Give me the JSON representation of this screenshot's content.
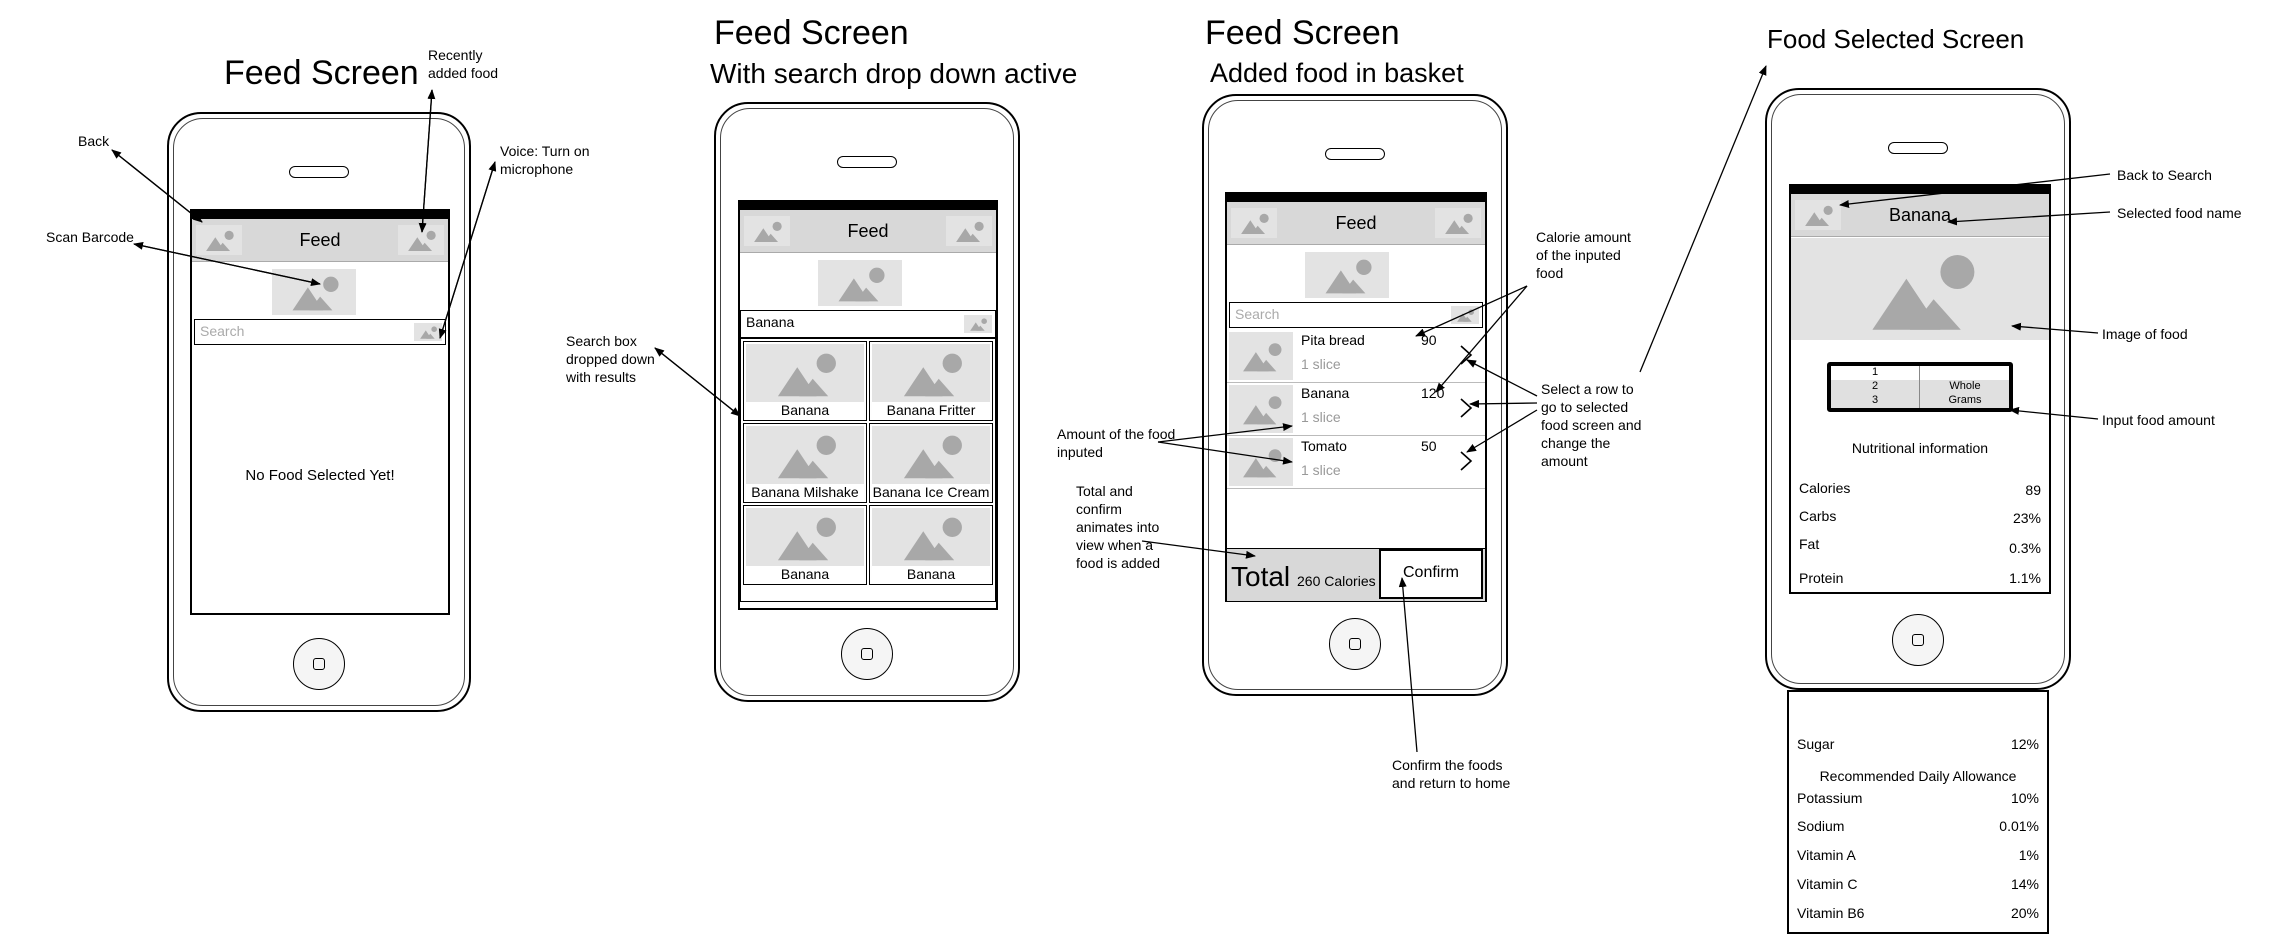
{
  "screen1": {
    "title": "Feed Screen",
    "nav_title": "Feed",
    "search_placeholder": "Search",
    "empty_text": "No Food Selected Yet!"
  },
  "screen2": {
    "title": "Feed Screen",
    "subtitle": "With search drop down active",
    "nav_title": "Feed",
    "search_value": "Banana",
    "results": [
      "Banana",
      "Banana Fritter",
      "Banana Milshake",
      "Banana Ice Cream",
      "Banana",
      "Banana"
    ]
  },
  "screen3": {
    "title": "Feed Screen",
    "subtitle": "Added food in basket",
    "nav_title": "Feed",
    "search_placeholder": "Search",
    "items": [
      {
        "name": "Pita bread",
        "calories": "90",
        "amount": "1 slice"
      },
      {
        "name": "Banana",
        "calories": "120",
        "amount": "1 slice"
      },
      {
        "name": "Tomato",
        "calories": "50",
        "amount": "1 slice"
      }
    ],
    "total_label": "Total",
    "total_value": "260 Calories",
    "confirm_label": "Confirm"
  },
  "screen4": {
    "title": "Food Selected Screen",
    "food_name": "Banana",
    "picker": [
      {
        "num": "1",
        "unit": ""
      },
      {
        "num": "2",
        "unit": "Whole"
      },
      {
        "num": "3",
        "unit": "Grams"
      }
    ],
    "nutrition_heading": "Nutritional information",
    "nutrition": [
      {
        "label": "Calories",
        "value": "89"
      },
      {
        "label": "Carbs",
        "value": "23%"
      },
      {
        "label": "Fat",
        "value": "0.3%"
      },
      {
        "label": "Protein",
        "value": "1.1%"
      }
    ],
    "extended": [
      {
        "label": "Sugar",
        "value": "12%"
      }
    ],
    "rda_heading": "Recommended Daily Allowance",
    "rda": [
      {
        "label": "Potassium",
        "value": "10%"
      },
      {
        "label": "Sodium",
        "value": "0.01%"
      },
      {
        "label": "Vitamin A",
        "value": "1%"
      },
      {
        "label": "Vitamin C",
        "value": "14%"
      },
      {
        "label": "Vitamin B6",
        "value": "20%"
      }
    ]
  },
  "annotations": {
    "back": "Back",
    "recently_added": "Recently\nadded food",
    "voice": "Voice: Turn on\nmicrophone",
    "scan_barcode": "Scan Barcode",
    "search_dropdown": "Search box\ndropped down\nwith results",
    "amount_inputed": "Amount of the food\ninputed",
    "total_confirm": "Total and\nconfirm\nanimates into\nview when a\nfood is added",
    "calorie_amount": "Calorie amount\nof the inputed\nfood",
    "select_row": "Select a row to\ngo to selected\nfood screen and\nchange the\namount",
    "confirm_foods": "Confirm the foods\nand return to home",
    "back_to_search": "Back to Search",
    "selected_food_name": "Selected food name",
    "image_of_food": "Image of food",
    "input_food_amount": "Input food amount"
  }
}
